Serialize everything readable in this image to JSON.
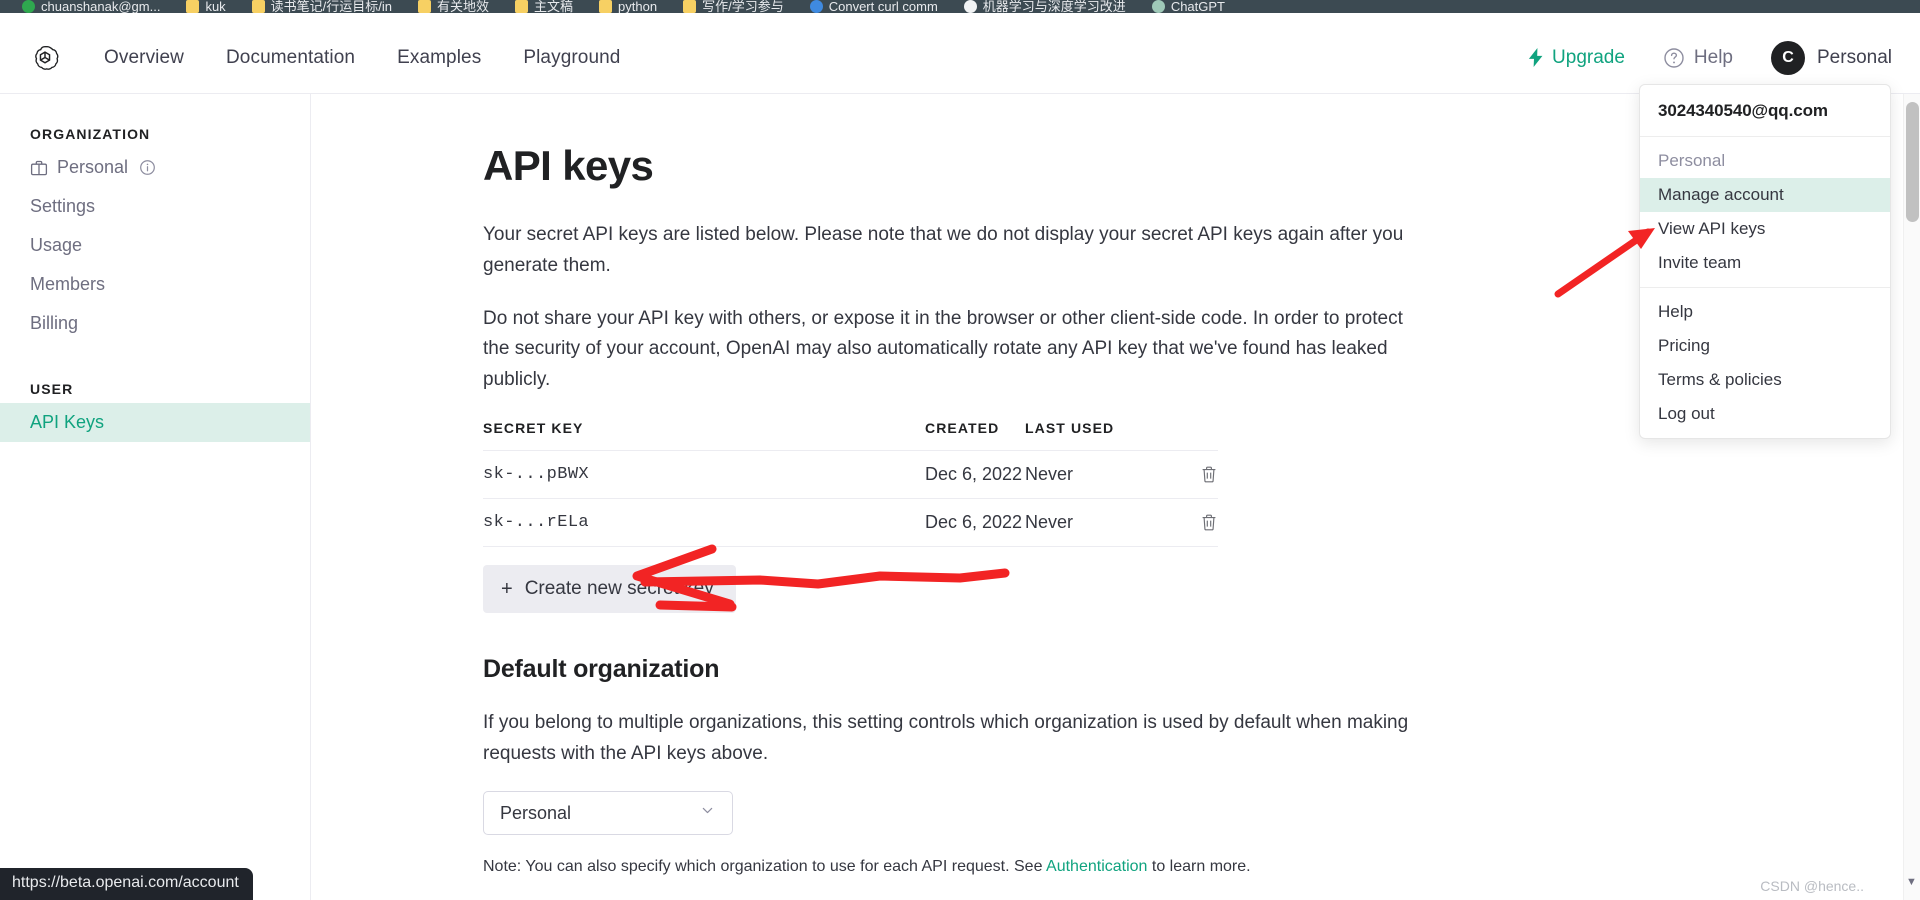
{
  "browser": {
    "bookmarks": [
      {
        "label": "chuanshanak@gm...",
        "icon": "green-circle-icon"
      },
      {
        "label": "kuk",
        "icon": "folder-icon"
      },
      {
        "label": "读书笔记/行运目标/in",
        "icon": "folder-icon"
      },
      {
        "label": "有关地效",
        "icon": "folder-icon"
      },
      {
        "label": "主文稿",
        "icon": "folder-icon"
      },
      {
        "label": "python",
        "icon": "folder-icon"
      },
      {
        "label": "写作/学习参与",
        "icon": "folder-icon"
      },
      {
        "label": "Convert curl comm",
        "icon": "blue-circle-icon"
      },
      {
        "label": "机器学习与深度学习改进",
        "icon": "white-circle-icon"
      },
      {
        "label": "ChatGPT",
        "icon": "teal-circle-icon"
      }
    ],
    "status_url": "https://beta.openai.com/account",
    "watermark": "CSDN @hence.."
  },
  "header": {
    "logo_name": "openai-logo",
    "nav": [
      {
        "label": "Overview"
      },
      {
        "label": "Documentation"
      },
      {
        "label": "Examples"
      },
      {
        "label": "Playground"
      }
    ],
    "upgrade_label": "Upgrade",
    "help_label": "Help",
    "avatar_initial": "C",
    "account_label": "Personal"
  },
  "account_menu": {
    "email": "3024340540@qq.com",
    "org_label": "Personal",
    "group_one": [
      {
        "label": "Manage account",
        "highlighted": true
      },
      {
        "label": "View API keys",
        "highlighted": false
      },
      {
        "label": "Invite team",
        "highlighted": false
      }
    ],
    "group_two": [
      {
        "label": "Help"
      },
      {
        "label": "Pricing"
      },
      {
        "label": "Terms & policies"
      },
      {
        "label": "Log out"
      }
    ]
  },
  "sidebar": {
    "org_heading": "ORGANIZATION",
    "org_items": [
      {
        "label": "Personal",
        "icon": "briefcase-icon",
        "has_info": true,
        "active": false
      },
      {
        "label": "Settings",
        "icon": "",
        "has_info": false,
        "active": false
      },
      {
        "label": "Usage",
        "icon": "",
        "has_info": false,
        "active": false
      },
      {
        "label": "Members",
        "icon": "",
        "has_info": false,
        "active": false
      },
      {
        "label": "Billing",
        "icon": "",
        "has_info": false,
        "active": false
      }
    ],
    "user_heading": "USER",
    "user_items": [
      {
        "label": "API Keys",
        "active": true
      }
    ]
  },
  "main": {
    "title": "API keys",
    "paragraph_1": "Your secret API keys are listed below. Please note that we do not display your secret API keys again after you generate them.",
    "paragraph_2": "Do not share your API key with others, or expose it in the browser or other client-side code. In order to protect the security of your account, OpenAI may also automatically rotate any API key that we've found has leaked publicly.",
    "table": {
      "columns": [
        "SECRET KEY",
        "CREATED",
        "LAST USED"
      ],
      "rows": [
        {
          "secret_key": "sk-...pBWX",
          "created": "Dec 6, 2022",
          "last_used": "Never",
          "delete_icon": "trash-icon"
        },
        {
          "secret_key": "sk-...rELa",
          "created": "Dec 6, 2022",
          "last_used": "Never",
          "delete_icon": "trash-icon"
        }
      ]
    },
    "create_button": {
      "plus": "+",
      "label": "Create new secret key"
    },
    "default_org": {
      "title": "Default organization",
      "description": "If you belong to multiple organizations, this setting controls which organization is used by default when making requests with the API keys above.",
      "select_value": "Personal",
      "note_prefix": "Note: You can also specify which organization to use for each API request. See ",
      "note_link": "Authentication",
      "note_suffix": " to learn more."
    }
  },
  "annotations": {
    "arrow_to_view_api_keys": "red-arrow-icon",
    "mark_on_create_button": "red-arrow-scribble-icon"
  },
  "colors": {
    "accent_green": "#10a37f",
    "highlight_bg": "#dcefe9",
    "annotation_red": "#f22424",
    "text_primary": "#202123",
    "text_secondary": "#6e6e80"
  }
}
